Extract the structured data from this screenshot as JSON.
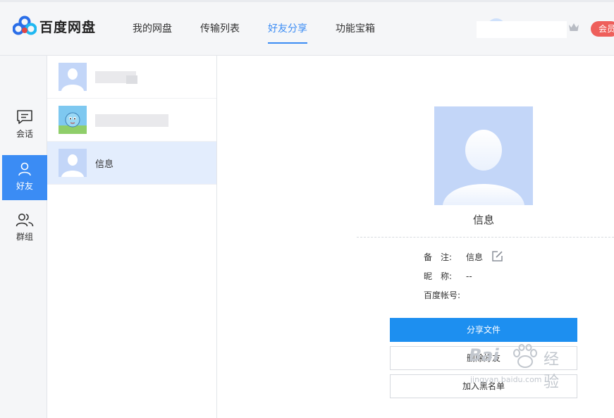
{
  "app": {
    "title": "百度网盘"
  },
  "nav": {
    "items": [
      "我的网盘",
      "传输列表",
      "好友分享",
      "功能宝箱"
    ],
    "active_index": 2
  },
  "header": {
    "vip_label": "会员"
  },
  "rail": {
    "items": [
      {
        "label": "会话",
        "icon": "chat-icon"
      },
      {
        "label": "好友",
        "icon": "person-icon"
      },
      {
        "label": "群组",
        "icon": "group-icon"
      }
    ],
    "active_index": 1
  },
  "friends": [
    {
      "name": "",
      "avatar": "default-avatar"
    },
    {
      "name": "",
      "avatar": "cartoon-avatar"
    },
    {
      "name": "信息",
      "avatar": "default-avatar"
    }
  ],
  "selected_friend_index": 2,
  "detail": {
    "name": "信息",
    "fields": [
      {
        "label": "备　注:",
        "value": "信息"
      },
      {
        "label": "昵　称:",
        "value": "--"
      },
      {
        "label": "百度帐号:",
        "value": ""
      }
    ],
    "buttons": {
      "share": "分享文件",
      "delete": "删除好友",
      "blacklist": "加入黑名单"
    }
  },
  "watermark": {
    "logo": "Bai",
    "cn": "经验",
    "url": "jingyan.baidu.com"
  },
  "colors": {
    "accent": "#3b8cf4",
    "primary_button": "#1d8ff0",
    "vip": "#ee5f5b",
    "avatar_bg": "#c3d6f8"
  }
}
